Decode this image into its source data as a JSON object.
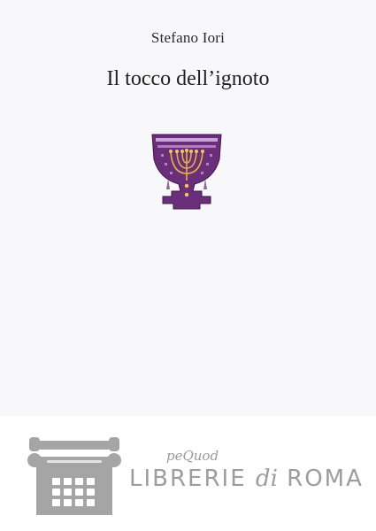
{
  "book": {
    "author": "Stefano Iori",
    "title": "Il tocco dell’ignoto"
  },
  "emblem": {
    "icon": "menorah-chalice-icon",
    "color": "#6a2e7a",
    "accent": "#e3b23c"
  },
  "publisher": {
    "imprint": "peQuod",
    "name_part1": "LIBRERIE",
    "name_part2": "di",
    "name_part3": "ROMA",
    "icon": "typewriter-icon"
  }
}
